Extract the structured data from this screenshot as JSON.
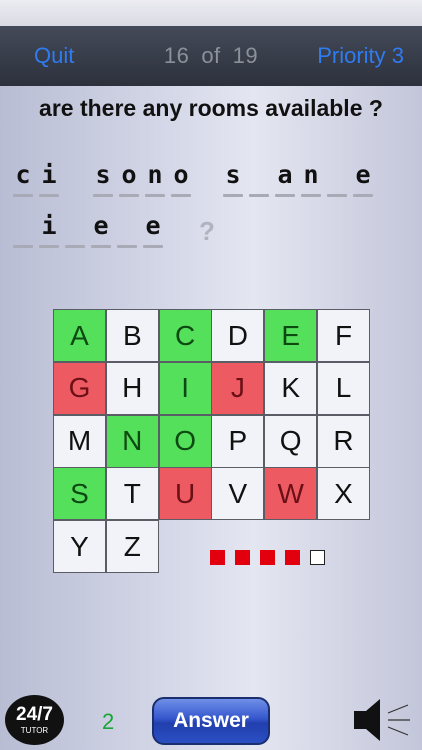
{
  "nav": {
    "quit": "Quit",
    "current": "16",
    "of": "of",
    "total": "19",
    "priority": "Priority 3"
  },
  "question": "are there any rooms available ?",
  "puzzle": {
    "line1": [
      "c",
      "i",
      "",
      "s",
      "o",
      "n",
      "o",
      "",
      "s",
      "",
      "a",
      "n",
      "",
      "e"
    ],
    "line2": [
      "",
      "i",
      "",
      "e",
      "",
      "e"
    ],
    "unknown_mark": "?"
  },
  "letters": [
    {
      "l": "A",
      "s": "correct"
    },
    {
      "l": "B",
      "s": "none"
    },
    {
      "l": "C",
      "s": "correct"
    },
    {
      "l": "D",
      "s": "none"
    },
    {
      "l": "E",
      "s": "correct"
    },
    {
      "l": "F",
      "s": "none"
    },
    {
      "l": "G",
      "s": "wrong"
    },
    {
      "l": "H",
      "s": "none"
    },
    {
      "l": "I",
      "s": "correct"
    },
    {
      "l": "J",
      "s": "wrong"
    },
    {
      "l": "K",
      "s": "none"
    },
    {
      "l": "L",
      "s": "none"
    },
    {
      "l": "M",
      "s": "none"
    },
    {
      "l": "N",
      "s": "correct"
    },
    {
      "l": "O",
      "s": "correct"
    },
    {
      "l": "P",
      "s": "none"
    },
    {
      "l": "Q",
      "s": "none"
    },
    {
      "l": "R",
      "s": "none"
    },
    {
      "l": "S",
      "s": "correct"
    },
    {
      "l": "T",
      "s": "none"
    },
    {
      "l": "U",
      "s": "wrong"
    },
    {
      "l": "V",
      "s": "none"
    },
    {
      "l": "W",
      "s": "wrong"
    },
    {
      "l": "X",
      "s": "none"
    },
    {
      "l": "Y",
      "s": "none"
    },
    {
      "l": "Z",
      "s": "none"
    }
  ],
  "lives": {
    "used": 4,
    "total": 5
  },
  "colors": {
    "correct": "#55e05c",
    "wrong": "#ee5a62",
    "accent": "#2f7bf0",
    "life": "#e3000e"
  },
  "footer": {
    "logo_main": "24/7",
    "logo_sub": "TUTOR",
    "hint_count": "2",
    "answer_label": "Answer",
    "speaker_icon": "speaker-icon"
  }
}
